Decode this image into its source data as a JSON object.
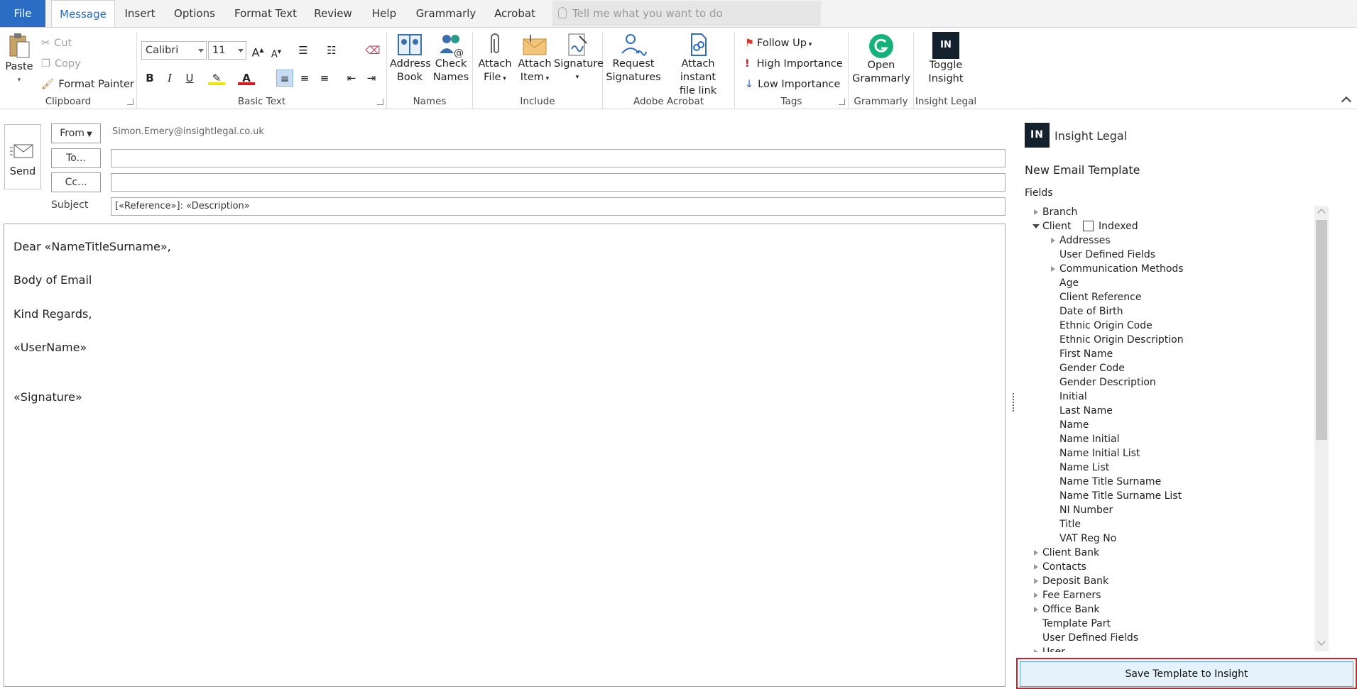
{
  "tabs": [
    "File",
    "Message",
    "Insert",
    "Options",
    "Format Text",
    "Review",
    "Help",
    "Grammarly",
    "Acrobat"
  ],
  "tell_me": "Tell me what you want to do",
  "ribbon": {
    "clipboard": {
      "paste": "Paste",
      "cut": "Cut",
      "copy": "Copy",
      "format_painter": "Format Painter",
      "label": "Clipboard"
    },
    "basic_text": {
      "font": "Calibri",
      "size": "11",
      "bold": "B",
      "italic": "I",
      "underline": "U",
      "label": "Basic Text"
    },
    "names": {
      "address_book_1": "Address",
      "address_book_2": "Book",
      "check_names_1": "Check",
      "check_names_2": "Names",
      "label": "Names"
    },
    "include": {
      "attach_file_1": "Attach",
      "attach_file_2": "File",
      "attach_item_1": "Attach",
      "attach_item_2": "Item",
      "signature": "Signature",
      "label": "Include"
    },
    "acrobat": {
      "request_1": "Request",
      "request_2": "Signatures",
      "instant_1": "Attach instant",
      "instant_2": "file link",
      "label": "Adobe Acrobat"
    },
    "tags": {
      "follow_up": "Follow Up",
      "high": "High Importance",
      "low": "Low Importance",
      "label": "Tags"
    },
    "grammarly": {
      "open_1": "Open",
      "open_2": "Grammarly",
      "label": "Grammarly"
    },
    "insight": {
      "toggle_1": "Toggle",
      "toggle_2": "Insight",
      "logo": "IN",
      "label": "Insight Legal"
    }
  },
  "compose": {
    "send": "Send",
    "from_btn": "From",
    "from_value": "Simon.Emery@insightlegal.co.uk",
    "to_btn": "To...",
    "cc_btn": "Cc...",
    "subject_label": "Subject",
    "subject_value": "[«Reference»]: «Description»",
    "body": [
      "Dear «NameTitleSurname»,",
      "Body of Email",
      "Kind Regards,",
      "«UserName»",
      "«Signature»"
    ]
  },
  "pane": {
    "logo": "IN",
    "brand": "Insight Legal",
    "title": "New Email Template",
    "fields_label": "Fields",
    "indexed": "Indexed",
    "save": "Save Template to Insight",
    "tree": {
      "branch": "Branch",
      "client": "Client",
      "client_children": [
        "Addresses",
        "User Defined Fields",
        "Communication Methods",
        "Age",
        "Client Reference",
        "Date of Birth",
        "Ethnic Origin Code",
        "Ethnic Origin Description",
        "First Name",
        "Gender Code",
        "Gender Description",
        "Initial",
        "Last Name",
        "Name",
        "Name Initial",
        "Name Initial List",
        "Name List",
        "Name Title Surname",
        "Name Title Surname List",
        "NI Number",
        "Title",
        "VAT Reg No"
      ],
      "after": [
        "Client Bank",
        "Contacts",
        "Deposit Bank",
        "Fee Earners",
        "Office Bank",
        "Template Part",
        "User Defined Fields",
        "User"
      ]
    }
  },
  "colors": {
    "accent": "#2b6cc4",
    "highlight": "#d01f2a",
    "logo_bg": "#13202e"
  }
}
